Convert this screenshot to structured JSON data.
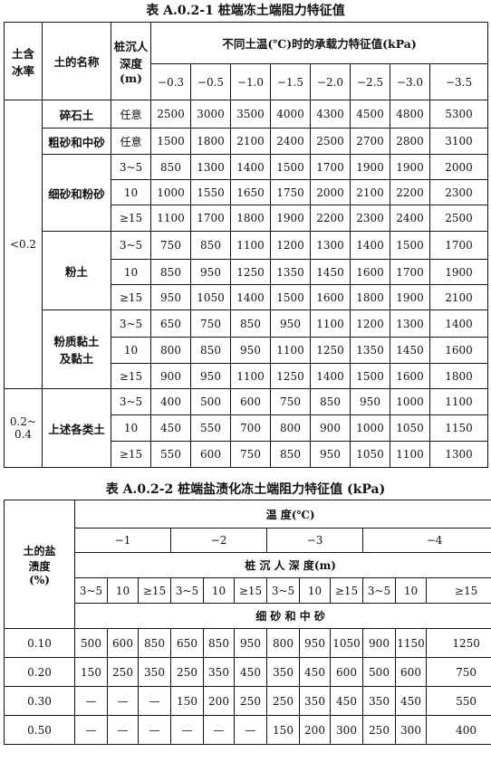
{
  "table1": {
    "title": "表 A.0.2-1   桩端冻土端阻力特征值",
    "header": {
      "ice_content": "土含\n冰率",
      "soil_name": "土的名称",
      "depth": "桩沉人\n深度\n(m)",
      "temp_group": "不同土温(℃)时的承载力特征值(kPa)",
      "temps": [
        "−0.3",
        "−0.5",
        "−1.0",
        "−1.5",
        "−2.0",
        "−2.5",
        "−3.0",
        "−3.5"
      ]
    },
    "ice_groups": [
      "<0.2",
      "0.2~\n0.4"
    ],
    "soil_groups": [
      "碎石土",
      "粗砂和中砂",
      "细砂和粉砂",
      "粉土",
      "粉质黏土\n及黏土",
      "上述各类土"
    ],
    "rows": [
      {
        "depth": "任意",
        "values": [
          "2500",
          "3000",
          "3500",
          "4000",
          "4300",
          "4500",
          "4800",
          "5300"
        ]
      },
      {
        "depth": "任意",
        "values": [
          "1500",
          "1800",
          "2100",
          "2400",
          "2500",
          "2700",
          "2800",
          "3100"
        ]
      },
      {
        "depth": "3~5",
        "values": [
          "850",
          "1300",
          "1400",
          "1500",
          "1700",
          "1900",
          "1900",
          "2000"
        ]
      },
      {
        "depth": "10",
        "values": [
          "1000",
          "1550",
          "1650",
          "1750",
          "2000",
          "2100",
          "2200",
          "2300"
        ]
      },
      {
        "depth": "≥15",
        "values": [
          "1100",
          "1700",
          "1800",
          "1900",
          "2200",
          "2300",
          "2400",
          "2500"
        ]
      },
      {
        "depth": "3~5",
        "values": [
          "750",
          "850",
          "1100",
          "1200",
          "1300",
          "1400",
          "1500",
          "1700"
        ]
      },
      {
        "depth": "10",
        "values": [
          "850",
          "950",
          "1250",
          "1350",
          "1450",
          "1600",
          "1700",
          "1900"
        ]
      },
      {
        "depth": "≥15",
        "values": [
          "950",
          "1050",
          "1400",
          "1500",
          "1600",
          "1800",
          "1900",
          "2100"
        ]
      },
      {
        "depth": "3~5",
        "values": [
          "650",
          "750",
          "850",
          "950",
          "1100",
          "1200",
          "1300",
          "1400"
        ]
      },
      {
        "depth": "10",
        "values": [
          "800",
          "850",
          "950",
          "1100",
          "1250",
          "1350",
          "1450",
          "1600"
        ]
      },
      {
        "depth": "≥15",
        "values": [
          "900",
          "950",
          "1100",
          "1250",
          "1400",
          "1500",
          "1600",
          "1800"
        ]
      },
      {
        "depth": "3~5",
        "values": [
          "400",
          "500",
          "600",
          "750",
          "850",
          "950",
          "1000",
          "1100"
        ]
      },
      {
        "depth": "10",
        "values": [
          "450",
          "550",
          "700",
          "800",
          "900",
          "1000",
          "1050",
          "1150"
        ]
      },
      {
        "depth": "≥15",
        "values": [
          "550",
          "600",
          "750",
          "850",
          "950",
          "1050",
          "1100",
          "1300"
        ]
      }
    ]
  },
  "table2": {
    "title": "表 A.0.2-2   桩端盐渍化冻土端阻力特征值 (kPa)",
    "header": {
      "salinity": "土的盐\n渍度\n(%)",
      "temp_label": "温   度(℃)",
      "temps": [
        "−1",
        "−2",
        "−3",
        "−4"
      ],
      "depth_label": "桩 沉 人 深 度(m)",
      "depths": [
        "3~5",
        "10",
        "≥15",
        "3~5",
        "10",
        "≥15",
        "3~5",
        "10",
        "≥15",
        "3~5",
        "10",
        "≥15"
      ],
      "soil_label": "细 砂 和 中 砂"
    },
    "rows": [
      {
        "salinity": "0.10",
        "values": [
          "500",
          "600",
          "850",
          "650",
          "850",
          "950",
          "800",
          "950",
          "1050",
          "900",
          "1150",
          "1250"
        ]
      },
      {
        "salinity": "0.20",
        "values": [
          "150",
          "250",
          "350",
          "250",
          "350",
          "450",
          "350",
          "450",
          "600",
          "500",
          "600",
          "750"
        ]
      },
      {
        "salinity": "0.30",
        "values": [
          "—",
          "—",
          "—",
          "150",
          "200",
          "250",
          "250",
          "350",
          "450",
          "350",
          "450",
          "550"
        ]
      },
      {
        "salinity": "0.50",
        "values": [
          "—",
          "—",
          "—",
          "—",
          "—",
          "—",
          "150",
          "200",
          "300",
          "250",
          "300",
          "400"
        ]
      }
    ]
  }
}
